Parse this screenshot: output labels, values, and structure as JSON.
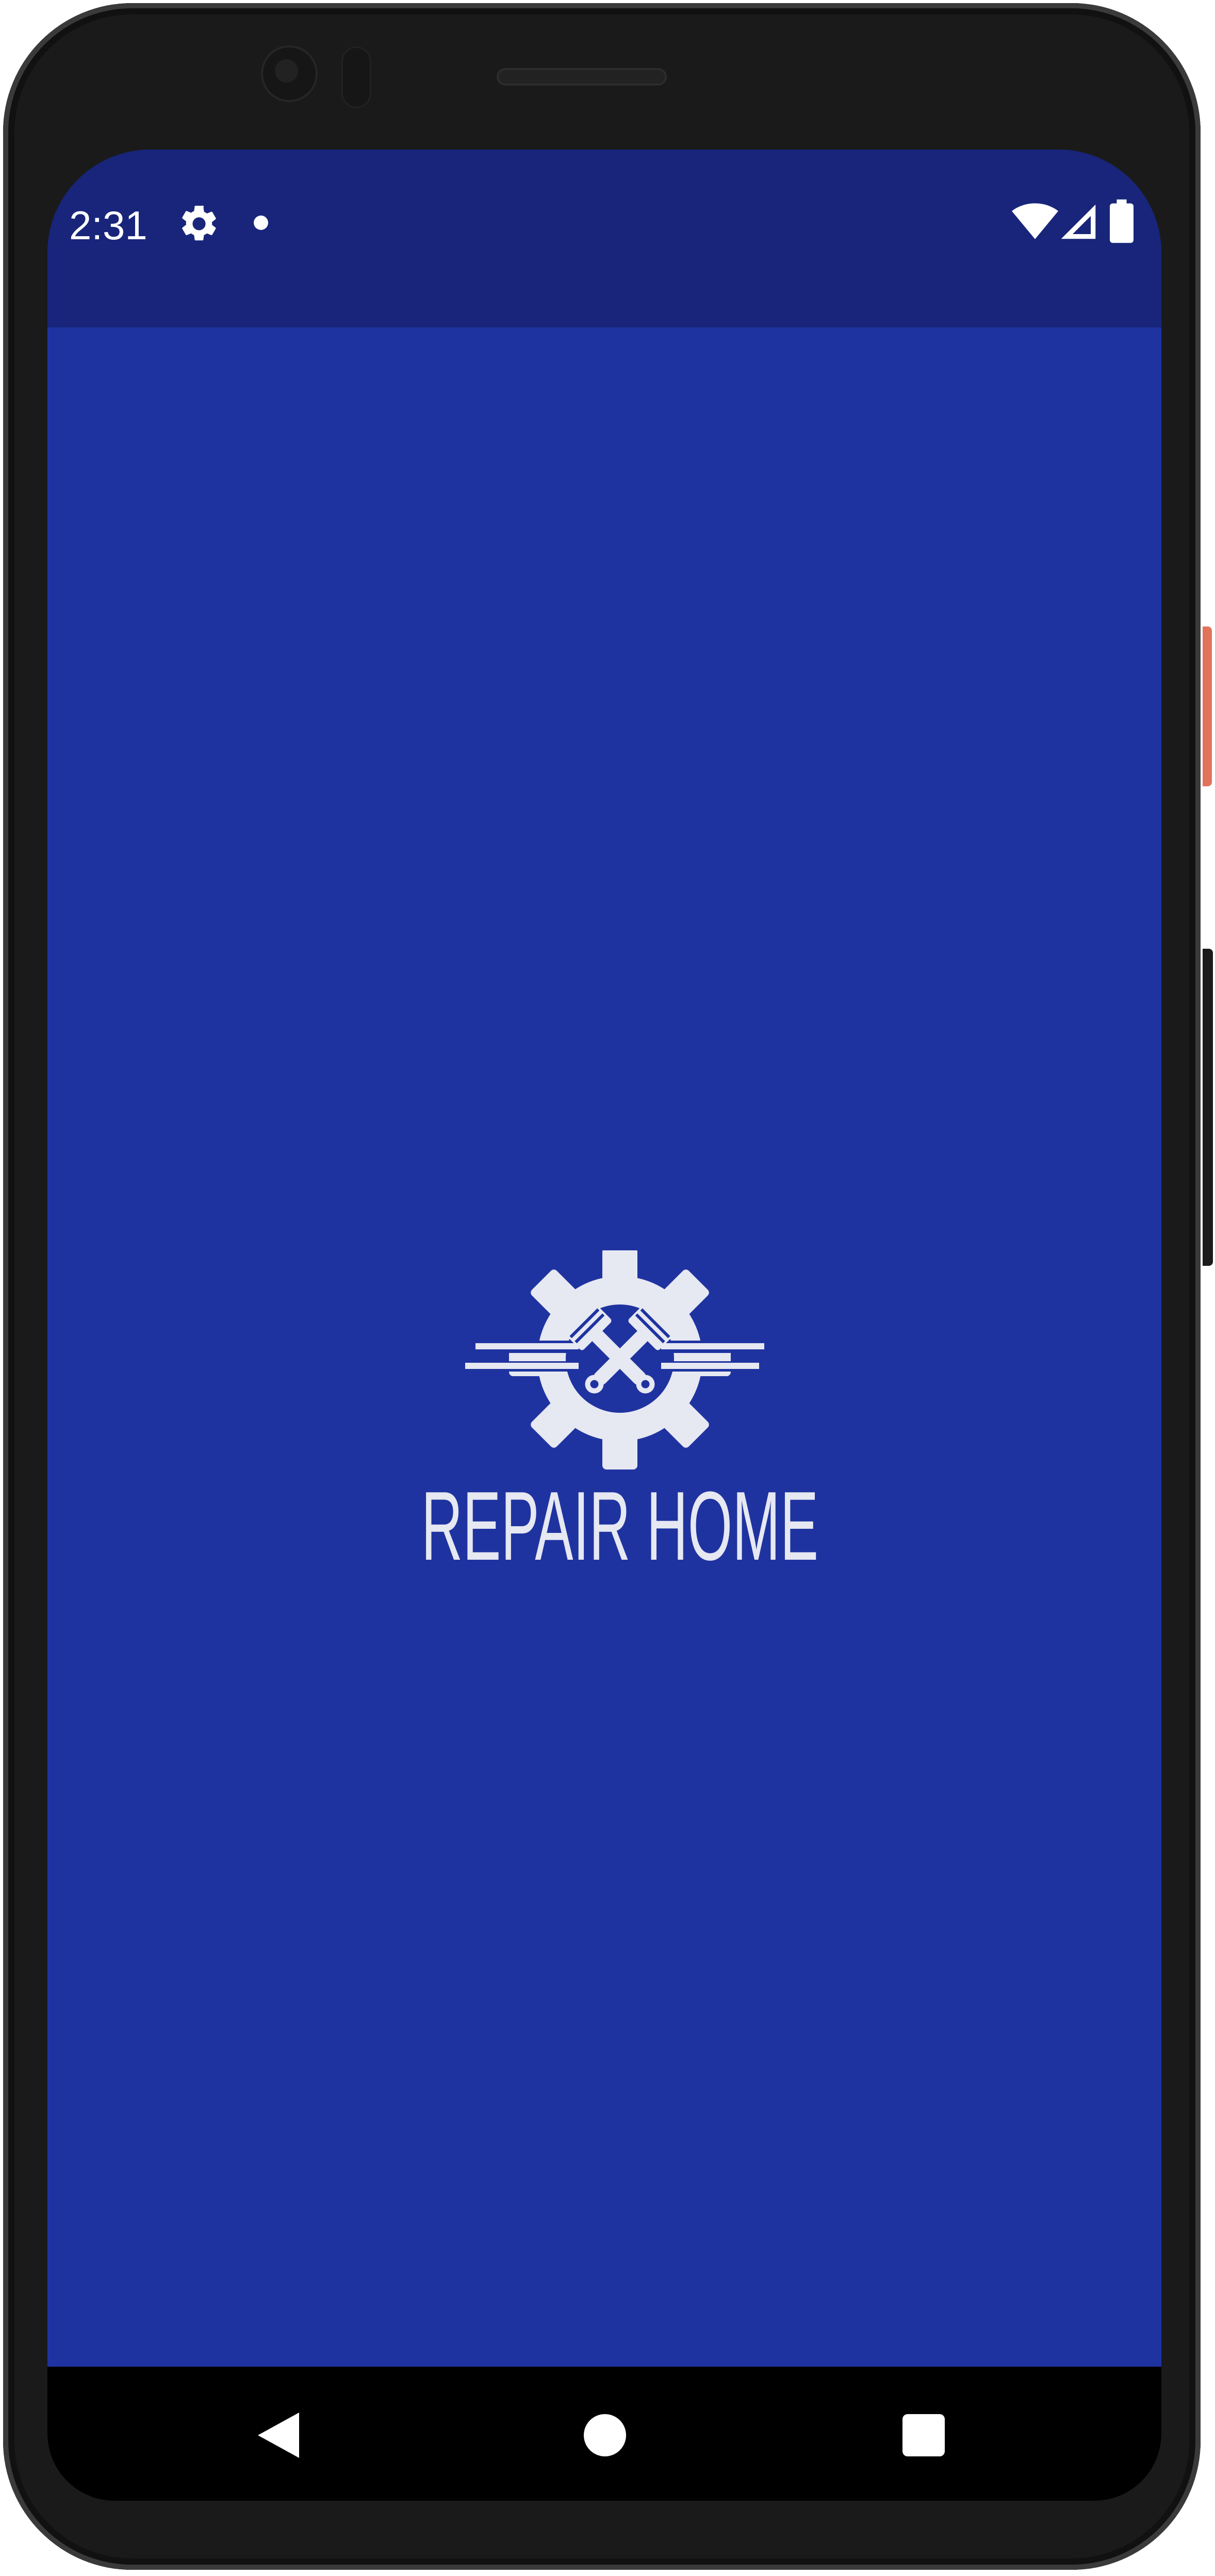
{
  "status_bar": {
    "time": "2:31",
    "icons": [
      "gear-icon",
      "notification-dot-icon",
      "wifi-icon",
      "cellular-signal-icon",
      "battery-icon"
    ]
  },
  "splash": {
    "brand_name": "REPAIR HOME",
    "logo_icon": "gear-with-crossed-pistons-icon"
  },
  "nav_bar": {
    "icons": [
      "back-icon",
      "home-icon",
      "recent-apps-icon"
    ]
  },
  "colors": {
    "status_bar_bg": "#18257a",
    "screen_bg": "#1f33a0",
    "logo_fg": "#e6e8f2",
    "nav_bar_bg": "#000000"
  }
}
